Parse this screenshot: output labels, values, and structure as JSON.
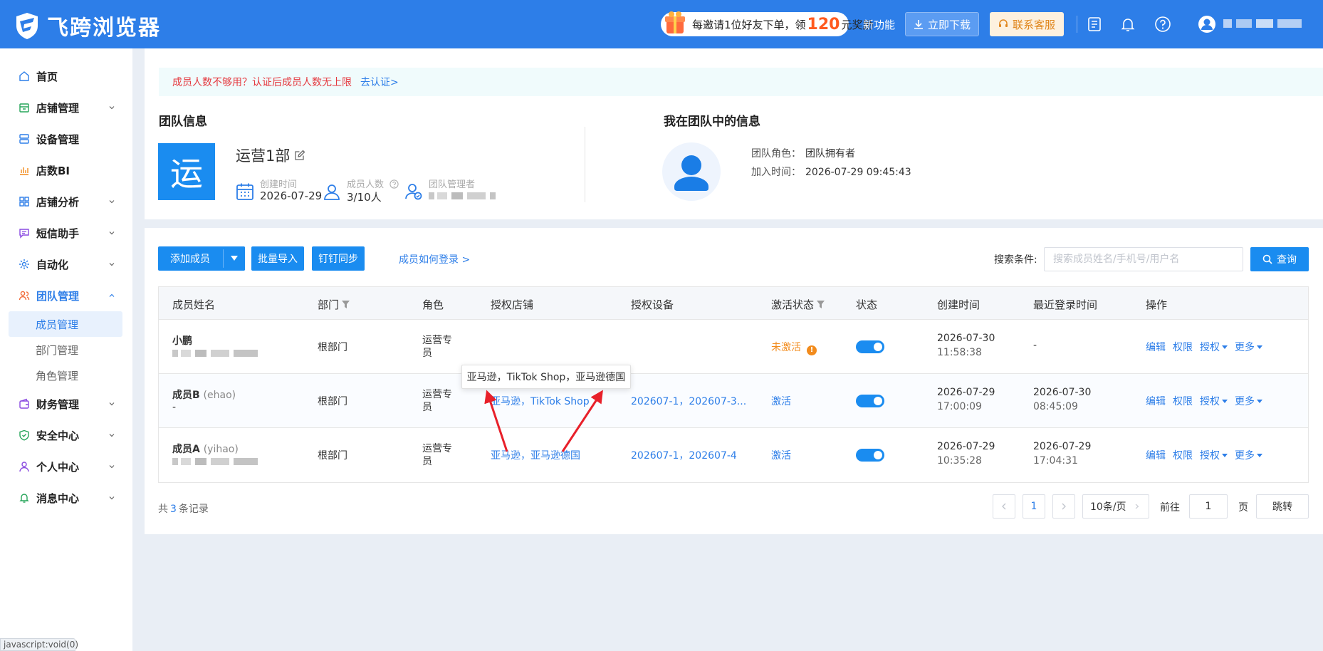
{
  "header": {
    "app_name": "飞跨浏览器",
    "invite_prefix": "每邀请1位好友下单，领",
    "invite_amount": "120",
    "invite_suffix": "元奖励",
    "new_features": "新功能",
    "download": "立即下载",
    "customer_service": "联系客服"
  },
  "sidebar": {
    "items": [
      {
        "label": "首页",
        "icon": "home-icon"
      },
      {
        "label": "店铺管理",
        "icon": "store-icon"
      },
      {
        "label": "设备管理",
        "icon": "device-icon"
      },
      {
        "label": "店数BI",
        "icon": "chart-icon"
      },
      {
        "label": "店铺分析",
        "icon": "grid-icon"
      },
      {
        "label": "短信助手",
        "icon": "message-icon"
      },
      {
        "label": "自动化",
        "icon": "gear-icon"
      },
      {
        "label": "团队管理",
        "icon": "team-icon"
      },
      {
        "label": "财务管理",
        "icon": "wallet-icon"
      },
      {
        "label": "安全中心",
        "icon": "shield-icon"
      },
      {
        "label": "个人中心",
        "icon": "user-icon"
      },
      {
        "label": "消息中心",
        "icon": "bell-icon"
      }
    ],
    "team_sub": [
      "成员管理",
      "部门管理",
      "角色管理"
    ],
    "accent": "#2d7ee8"
  },
  "status_bar": "javascript:void(0)",
  "notice": {
    "text": "成员人数不够用？认证后成员人数无上限",
    "link": "去认证>"
  },
  "team": {
    "section_title": "团队信息",
    "avatar_char": "运",
    "name": "运营1部",
    "created_label": "创建时间",
    "created_value": "2026-07-29",
    "members_label": "成员人数",
    "members_value": "3/10人",
    "admin_label": "团队管理者"
  },
  "me": {
    "section_title": "我在团队中的信息",
    "role_label": "团队角色：",
    "role_value": "团队拥有者",
    "join_label": "加入时间：",
    "join_value": "2026-07-29 09:45:43"
  },
  "toolbar": {
    "add_member": "添加成员",
    "batch_import": "批量导入",
    "dingtalk_sync": "钉钉同步",
    "how_login": "成员如何登录 >",
    "search_label": "搜索条件:",
    "search_placeholder": "搜索成员姓名/手机号/用户名",
    "query": "查询"
  },
  "table": {
    "headers": [
      "成员姓名",
      "部门",
      "角色",
      "授权店铺",
      "授权设备",
      "激活状态",
      "状态",
      "创建时间",
      "最近登录时间",
      "操作"
    ],
    "rows": [
      {
        "name": "小鹏",
        "account": "",
        "dept": "根部门",
        "role": "运营专员",
        "shops": "",
        "devices": "",
        "activation": "未激活",
        "created_date": "2026-07-30",
        "created_time": "11:58:38",
        "last_date": "-",
        "last_time": ""
      },
      {
        "name": "成员B",
        "account": "(ehao)",
        "sub": "-",
        "dept": "根部门",
        "role": "运营专员",
        "shops": "亚马逊，TikTok Shop",
        "devices": "202607-1，202607-3...",
        "activation": "激活",
        "created_date": "2026-07-29",
        "created_time": "17:00:09",
        "last_date": "2026-07-30",
        "last_time": "08:45:09"
      },
      {
        "name": "成员A",
        "account": "(yihao)",
        "dept": "根部门",
        "role": "运营专员",
        "shops": "亚马逊，亚马逊德国",
        "devices": "202607-1，202607-4",
        "activation": "激活",
        "created_date": "2026-07-29",
        "created_time": "10:35:28",
        "last_date": "2026-07-29",
        "last_time": "17:04:31"
      }
    ],
    "ops": [
      "编辑",
      "权限",
      "授权",
      "更多"
    ]
  },
  "tooltip": "亚马逊，TikTok Shop，亚马逊德国",
  "pagination": {
    "total_prefix": "共",
    "total": "3",
    "total_suffix": "条记录",
    "page": "1",
    "page_size": "10条/页",
    "goto_label": "前往",
    "goto_value": "1",
    "page_unit": "页",
    "jump": "跳转"
  },
  "colors": {
    "header": "#2d7ee8",
    "primary": "#1a8cf0",
    "warn": "#f28b1c",
    "arrow": "#e8202a"
  }
}
